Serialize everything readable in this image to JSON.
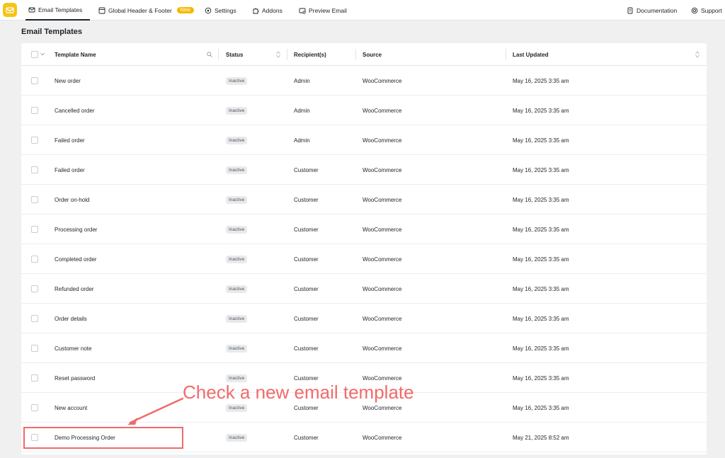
{
  "nav": {
    "items": [
      {
        "label": "Email Templates",
        "icon": "mail-icon"
      },
      {
        "label": "Global Header & Footer",
        "icon": "layout-icon",
        "badge": "New"
      },
      {
        "label": "Settings",
        "icon": "settings-icon"
      },
      {
        "label": "Addons",
        "icon": "puzzle-icon"
      },
      {
        "label": "Preview Email",
        "icon": "preview-icon"
      }
    ],
    "right": [
      {
        "label": "Documentation",
        "icon": "document-icon"
      },
      {
        "label": "Support",
        "icon": "lifebuoy-icon"
      }
    ]
  },
  "page": {
    "title": "Email Templates"
  },
  "table": {
    "columns": [
      "Template Name",
      "Status",
      "Recipient(s)",
      "Source",
      "Last Updated"
    ],
    "rows": [
      {
        "name": "New order",
        "status": "Inactive",
        "recipient": "Admin",
        "source": "WooCommerce",
        "updated": "May 16, 2025 3:35 am"
      },
      {
        "name": "Cancelled order",
        "status": "Inactive",
        "recipient": "Admin",
        "source": "WooCommerce",
        "updated": "May 16, 2025 3:35 am"
      },
      {
        "name": "Failed order",
        "status": "Inactive",
        "recipient": "Admin",
        "source": "WooCommerce",
        "updated": "May 16, 2025 3:35 am"
      },
      {
        "name": "Failed order",
        "status": "Inactive",
        "recipient": "Customer",
        "source": "WooCommerce",
        "updated": "May 16, 2025 3:35 am"
      },
      {
        "name": "Order on-hold",
        "status": "Inactive",
        "recipient": "Customer",
        "source": "WooCommerce",
        "updated": "May 16, 2025 3:35 am"
      },
      {
        "name": "Processing order",
        "status": "Inactive",
        "recipient": "Customer",
        "source": "WooCommerce",
        "updated": "May 16, 2025 3:35 am"
      },
      {
        "name": "Completed order",
        "status": "Inactive",
        "recipient": "Customer",
        "source": "WooCommerce",
        "updated": "May 16, 2025 3:35 am"
      },
      {
        "name": "Refunded order",
        "status": "Inactive",
        "recipient": "Customer",
        "source": "WooCommerce",
        "updated": "May 16, 2025 3:35 am"
      },
      {
        "name": "Order details",
        "status": "Inactive",
        "recipient": "Customer",
        "source": "WooCommerce",
        "updated": "May 16, 2025 3:35 am"
      },
      {
        "name": "Customer note",
        "status": "Inactive",
        "recipient": "Customer",
        "source": "WooCommerce",
        "updated": "May 16, 2025 3:35 am"
      },
      {
        "name": "Reset password",
        "status": "Inactive",
        "recipient": "Customer",
        "source": "WooCommerce",
        "updated": "May 16, 2025 3:35 am"
      },
      {
        "name": "New account",
        "status": "Inactive",
        "recipient": "Customer",
        "source": "WooCommerce",
        "updated": "May 16, 2025 3:35 am"
      },
      {
        "name": "Demo Processing Order",
        "status": "Inactive",
        "recipient": "Customer",
        "source": "WooCommerce",
        "updated": "May 21, 2025 8:52 am"
      }
    ]
  },
  "annotation": {
    "text": "Check a new email template",
    "color": "#f26a6a"
  },
  "colors": {
    "accent": "#f5c518",
    "badge": "#f5b800"
  }
}
